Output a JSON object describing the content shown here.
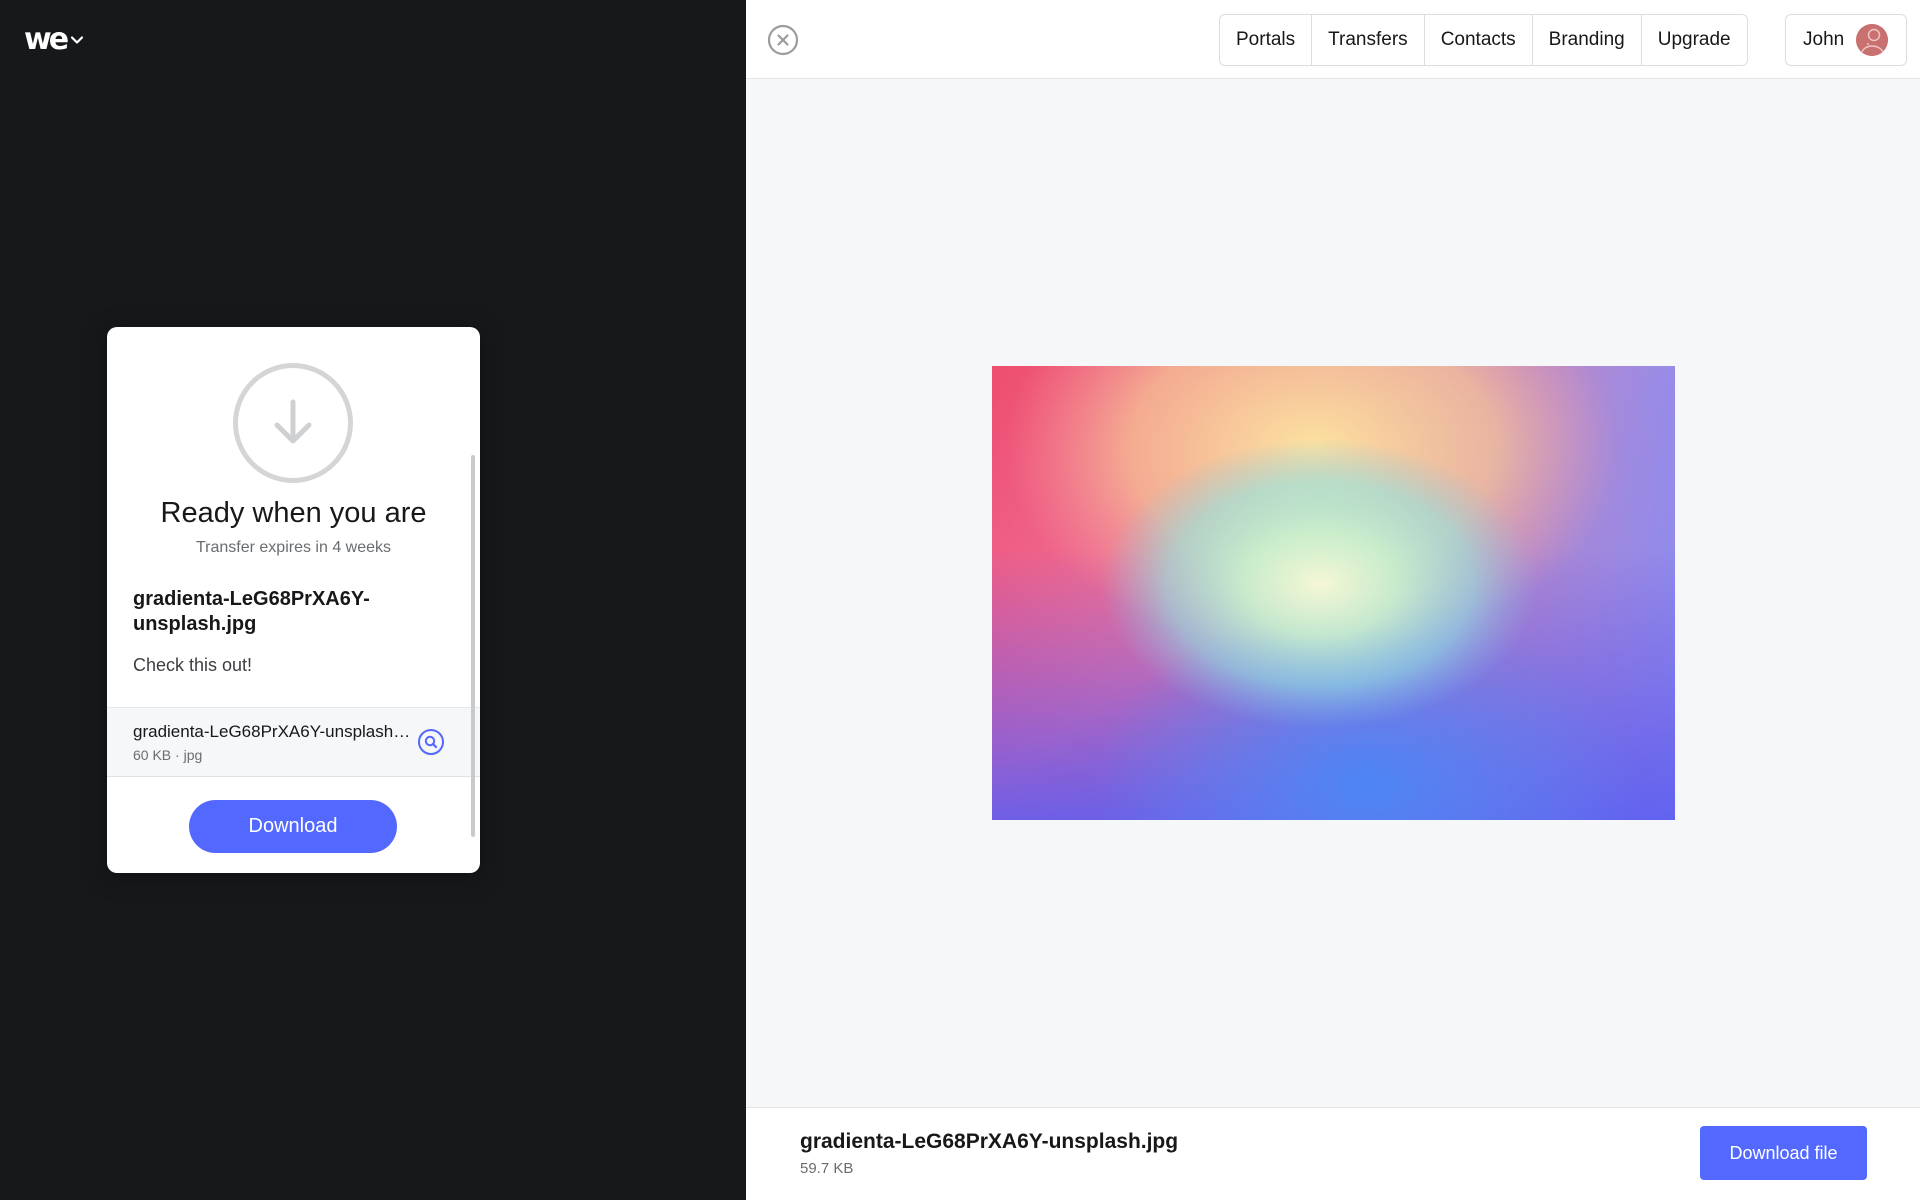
{
  "app": {
    "logo_text": "we",
    "logo_icon": "wetransfer-logo-icon",
    "menu_icon": "chevron-down-icon"
  },
  "card": {
    "title": "Ready when you are",
    "subtitle": "Transfer expires in 4 weeks",
    "file_title": "gradienta-LeG68PrXA6Y-unsplash.jpg",
    "message": "Check this out!",
    "files": [
      {
        "name": "gradienta-LeG68PrXA6Y-unsplash.jpg",
        "size": "60 KB",
        "type": "jpg",
        "meta": "60 KB · jpg"
      }
    ],
    "download_label": "Download",
    "icon": "download-arrow-icon"
  },
  "topbar": {
    "nav": [
      "Portals",
      "Transfers",
      "Contacts",
      "Branding",
      "Upgrade"
    ],
    "user_name": "John",
    "close_icon": "close-icon"
  },
  "preview": {
    "file_name": "gradienta-LeG68PrXA6Y-unsplash.jpg",
    "file_size": "59.7 KB",
    "download_label": "Download file"
  },
  "colors": {
    "accent": "#5268ff",
    "dark_bg": "#17181a",
    "light_bg": "#f6f7f9"
  }
}
